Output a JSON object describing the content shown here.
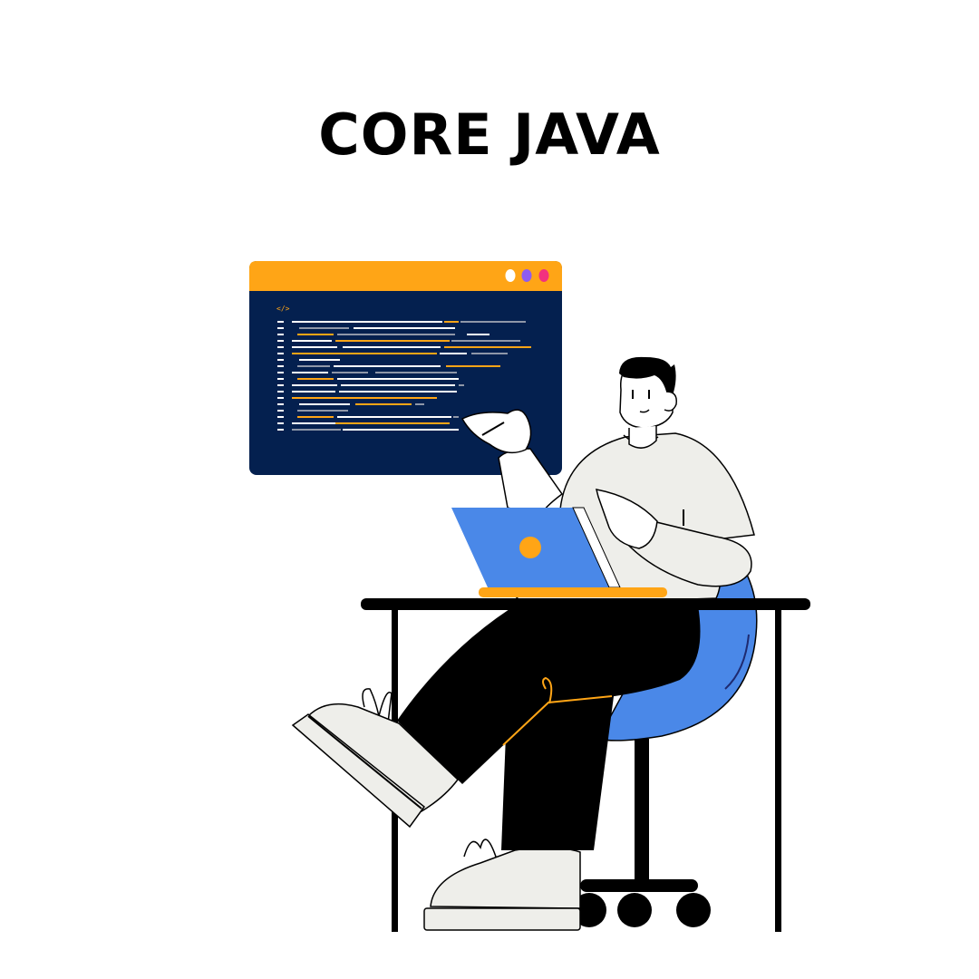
{
  "title": "CORE JAVA",
  "code_window": {
    "tag": "</>",
    "window_dots": [
      "#ffffff",
      "#8e5cf0",
      "#f2317f"
    ]
  },
  "colors": {
    "orange": "#ffa516",
    "navy": "#04204f",
    "blue": "#4a88e8",
    "shirt": "#eeeeea",
    "black": "#000000",
    "code_white": "#ffffff",
    "code_gray": "#8f97a8"
  },
  "icons": [
    "code-icon",
    "laptop-logo-icon"
  ]
}
